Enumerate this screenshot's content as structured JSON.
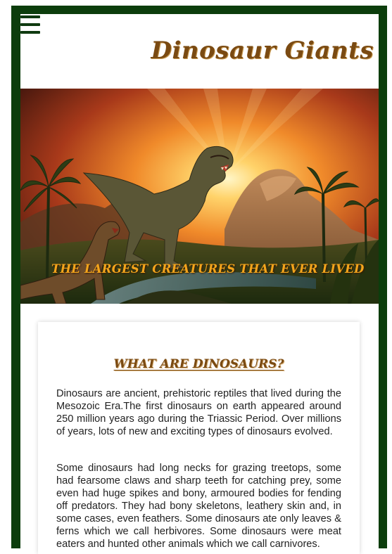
{
  "header": {
    "menu_icon": "hamburger-menu-icon",
    "site_title": "Dinosaur Giants"
  },
  "hero": {
    "image": "t-rex-prehistoric-landscape-illustration",
    "tagline": "THE LARGEST CREATURES THAT EVER LIVED"
  },
  "article": {
    "heading": "WHAT ARE DINOSAURS?",
    "paragraphs": [
      "Dinosaurs are ancient, prehistoric reptiles that lived during the Mesozoic Era.The first dinosaurs on earth appeared around 250 million years ago during the Triassic Period. Over millions of years, lots of new and exciting types of dinosaurs evolved.",
      "Some dinosaurs had long necks for grazing treetops, some had fearsome claws and sharp teeth for catching prey, some even had huge spikes and bony, armoured bodies for fending off predators. They had bony skeletons, leathery skin and, in some cases, even feathers. Some dinosaurs ate only leaves & ferns which we call herbivores. Some dinosaurs were meat eaters and hunted other animals which we call carnivores."
    ]
  },
  "colors": {
    "frame_green": "#0c3d0c",
    "title_brown": "#7a4a12",
    "tagline_orange": "#f4a51c"
  }
}
